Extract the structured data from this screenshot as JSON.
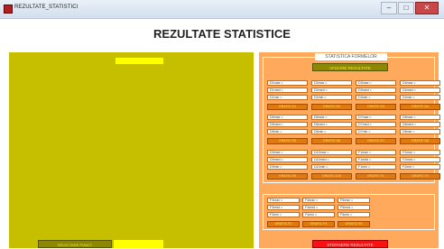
{
  "window": {
    "title": "REZULTATE_STATISTICI"
  },
  "main": {
    "title": "REZULTATE STATISTICE"
  },
  "left": {
    "select_label": "SELECTARE PUNCT"
  },
  "right": {
    "frame_label": "STATISTICA FORMELOR",
    "afis_label": "AFISARE REZULTATE",
    "groups": [
      {
        "rows": [
          [
            "D1max =",
            "D2max =",
            "D3max =",
            "D4max ="
          ],
          [
            "D1med =",
            "D2med =",
            "D3med =",
            "D4med ="
          ],
          [
            "D1min =",
            "D2min =",
            "D3min =",
            "D4min ="
          ]
        ],
        "buttons": [
          "GRAFIC D1",
          "GRAFIC D2",
          "GRAFIC D3",
          "GRAFIC D4"
        ]
      },
      {
        "rows": [
          [
            "D5max =",
            "D6max =",
            "D7max =",
            "D8max ="
          ],
          [
            "D5med =",
            "D6med =",
            "D7med =",
            "D8med ="
          ],
          [
            "D5min =",
            "D6min =",
            "D7min =",
            "D8min ="
          ]
        ],
        "buttons": [
          "GRAFIC D5",
          "GRAFIC D6",
          "GRAFIC D7",
          "GRAFIC D8"
        ]
      },
      {
        "rows": [
          [
            "D9max =",
            "D10max =",
            "F1max =",
            "F2max ="
          ],
          [
            "D9med =",
            "D10med =",
            "F1med =",
            "F2med ="
          ],
          [
            "D9min =",
            "D10min =",
            "F1min =",
            "F2min ="
          ]
        ],
        "buttons": [
          "GRAFIC D9",
          "GRAFIC D10",
          "GRAFIC F1",
          "GRAFIC F2"
        ]
      }
    ],
    "group4": {
      "rows": [
        [
          "F3max =",
          "F4max =",
          "F5max ="
        ],
        [
          "F3med =",
          "F4med =",
          "F5med ="
        ],
        [
          "F3min =",
          "F4min =",
          "F5min ="
        ]
      ],
      "buttons": [
        "GRAFIC F3",
        "GRAFIC F4",
        "GRAFIC F5"
      ]
    },
    "bottom_label": "STERGERE REZULTATE"
  }
}
